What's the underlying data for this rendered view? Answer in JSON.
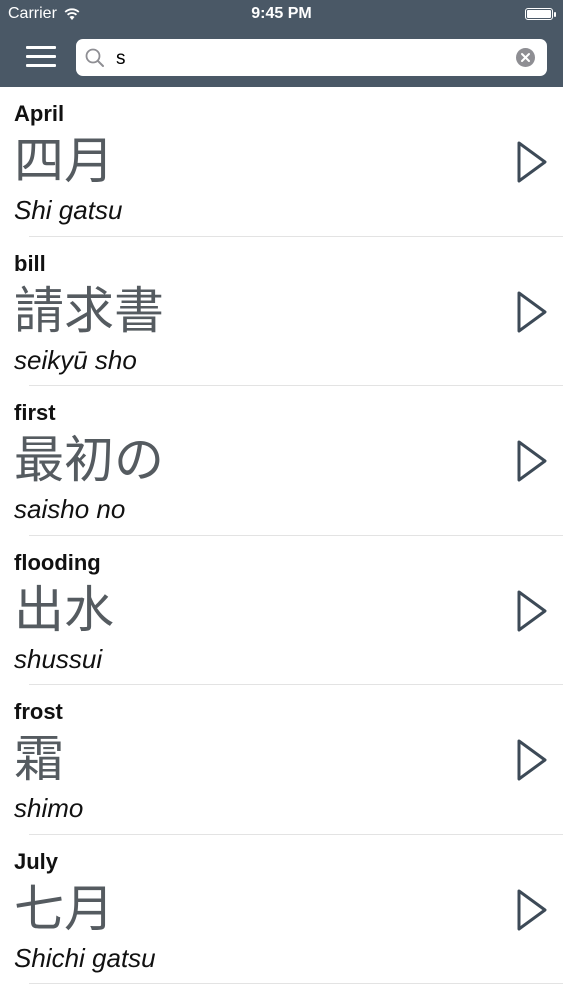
{
  "status_bar": {
    "carrier": "Carrier",
    "time": "9:45 PM"
  },
  "search": {
    "value": "s",
    "placeholder": ""
  },
  "entries": [
    {
      "english": "April",
      "japanese": "四月",
      "romaji": "Shi gatsu"
    },
    {
      "english": "bill",
      "japanese": "請求書",
      "romaji": "seikyū sho"
    },
    {
      "english": "first",
      "japanese": "最初の",
      "romaji": "saisho no"
    },
    {
      "english": "flooding",
      "japanese": "出水",
      "romaji": "shussui"
    },
    {
      "english": "frost",
      "japanese": "霜",
      "romaji": "shimo"
    },
    {
      "english": "July",
      "japanese": "七月",
      "romaji": "Shichi gatsu"
    }
  ],
  "icons": {
    "menu": "hamburger-menu-icon",
    "search": "magnifier-icon",
    "clear": "clear-x-icon",
    "play": "play-triangle-icon",
    "wifi": "wifi-icon",
    "battery": "battery-icon"
  },
  "colors": {
    "nav_bar": "#4a5866",
    "kanji": "#555b60",
    "play_icon": "#3d4a57"
  }
}
